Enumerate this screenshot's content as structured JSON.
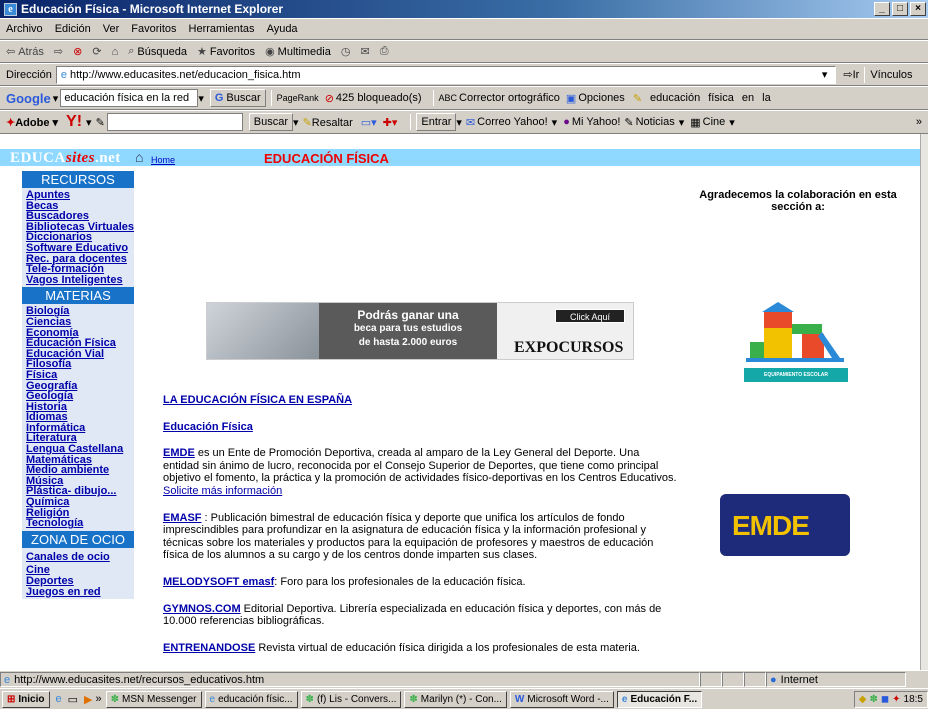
{
  "window": {
    "title": "Educación Física - Microsoft Internet Explorer",
    "buttons": [
      "_",
      "□",
      "×"
    ]
  },
  "menu": {
    "items": [
      "Archivo",
      "Edición",
      "Ver",
      "Favoritos",
      "Herramientas",
      "Ayuda"
    ]
  },
  "toolbar": {
    "back": "Atrás",
    "search": "Búsqueda",
    "favorites": "Favoritos",
    "multimedia": "Multimedia"
  },
  "address": {
    "label": "Dirección",
    "url": "http://www.educasites.net/educacion_fisica.htm",
    "go": "Ir",
    "links": "Vínculos"
  },
  "google": {
    "label": "Google",
    "query": "educación física en la red",
    "buscar": "Buscar",
    "pagerank": "PageRank",
    "blocked": "425 bloqueado(s)",
    "spell": "Corrector ortográfico",
    "options": "Opciones",
    "term1": "educación",
    "term2": "física",
    "term3": "en",
    "term4": "la"
  },
  "yahoo": {
    "adobe": "Adobe",
    "buscar": "Buscar",
    "resaltar": "Resaltar",
    "entrar": "Entrar",
    "correo": "Correo Yahoo!",
    "miyahoo": "Mi Yahoo!",
    "noticias": "Noticias",
    "cine": "Cine"
  },
  "site": {
    "logo_a": "EDUCA",
    "logo_b": "sites",
    "logo_c": ".net",
    "home": "Home",
    "section_title": "EDUCACIÓN  FÍSICA",
    "recursos_title": "RECURSOS",
    "recursos": [
      "Apuntes",
      "Becas",
      "Buscadores",
      "Bibliotecas Virtuales",
      "Diccionarios",
      "Software Educativo",
      "Rec. para docentes",
      "Tele-formación",
      "Vagos Inteligentes"
    ],
    "materias_title": "MATERIAS",
    "materias": [
      "Biología",
      "Ciencias",
      "Economía",
      "Educación Física",
      "Educación Vial",
      "Filosofía",
      "Física",
      "Geografía",
      "Geología",
      "Historia",
      "Idiomas",
      "Informática",
      "Literatura",
      "Lengua Castellana",
      "Matemáticas",
      "Medio ambiente",
      "Música",
      "Plástica- dibujo...",
      "Química",
      "Religión",
      "Tecnología"
    ],
    "ocio_title": "ZONA DE OCIO",
    "ocio": [
      "Canales de ocio",
      "Cine",
      "Deportes",
      "Juegos en red"
    ],
    "banner": {
      "line1": "Podrás ganar una",
      "line2": "beca para tus estudios",
      "line3": "de hasta 2.000 euros",
      "click": "Click Aquí",
      "brand": "EXPOCURSOS"
    },
    "heading1": "LA EDUCACIÓN FÍSICA EN ESPAÑA",
    "heading2": "Educación Física",
    "entries": [
      {
        "name": "EMDE",
        "text": " es un Ente de Promoción Deportiva, creada al amparo de la Ley General del Deporte. Una entidad sin ánimo de lucro, reconocida por el Consejo Superior de Deportes, que tiene como principal objetivo el fomento, la práctica y la promoción de actividades físico-deportivas en los Centros Educativos. ",
        "link": "Solicite más información"
      },
      {
        "name": "EMASF",
        "text": " : Publicación bimestral de educación física y deporte que unifica los artículos de fondo imprescindibles para profundizar en la asignatura de educación física y la información profesional y técnicas sobre los materiales y productos para la equipación de profesores y maestros de educación física de los alumnos a su cargo y de los centros donde imparten sus clases.",
        "link": ""
      },
      {
        "name": "MELODYSOFT emasf",
        "text": ": Foro para los profesionales de la educación física.",
        "link": ""
      },
      {
        "name": "GYMNOS.COM",
        "text": " Editorial Deportiva. Librería especializada en educación física y deportes,  con más de 10.000 referencias bibliográficas.",
        "link": ""
      },
      {
        "name": "ENTRENANDOSE",
        "text": " Revista virtual de educación física dirigida a los profesionales de esta materia.",
        "link": ""
      }
    ],
    "thanks": "Agradecemos la colaboración en esta sección a:",
    "playground_label": "EQUIPAMIENTO ESCOLAR",
    "emde_logo": "EMDE"
  },
  "status": {
    "url": "http://www.educasites.net/recursos_educativos.htm",
    "zone": "Internet"
  },
  "taskbar": {
    "start": "Inicio",
    "tasks": [
      "MSN Messenger",
      "educación físic...",
      "(f) Lis - Convers...",
      "Marilyn (*) - Con...",
      "Microsoft Word -...",
      "Educación F..."
    ],
    "clock": "18:5"
  }
}
